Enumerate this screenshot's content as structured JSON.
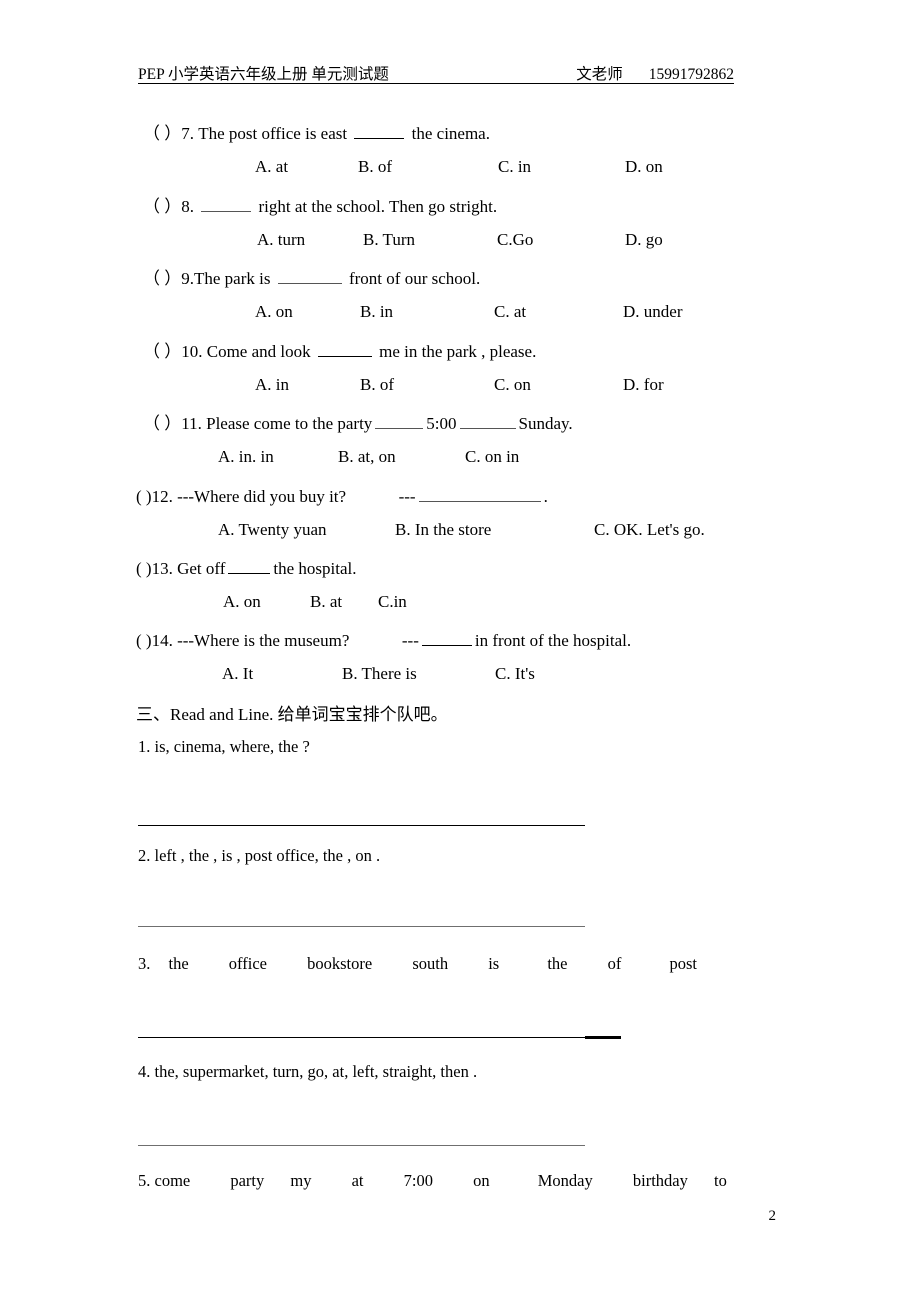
{
  "header": {
    "title": "PEP 小学英语六年级上册  单元测试题",
    "teacher": "文老师",
    "phone": "15991792862"
  },
  "multiple_choice": {
    "questions": [
      {
        "marker": "（    ）",
        "number": "7.",
        "stem_before": "The post office is east",
        "stem_after": "the cinema.",
        "options": [
          "A. at",
          "B. of",
          "C. in",
          "D. on"
        ]
      },
      {
        "marker": "（    ）",
        "number": "8.",
        "stem_before": "",
        "stem_after": "right at the school. Then go stright.",
        "options": [
          "A. turn",
          "B. Turn",
          "C.Go",
          "D. go"
        ]
      },
      {
        "marker": "（    ）",
        "number": "9.",
        "stem_before": "The park is",
        "stem_after": "front of our school.",
        "options": [
          "A. on",
          "B. in",
          "C. at",
          "D. under"
        ]
      },
      {
        "marker": "（    ）",
        "number": "10.",
        "stem_before": "Come and look",
        "stem_after": "me in the park , please.",
        "options": [
          "A. in",
          "B. of",
          "C. on",
          "D. for"
        ]
      },
      {
        "marker": "（    ）",
        "number": "11.",
        "stem_before": "Please come to the party",
        "stem_mid": "5:00",
        "stem_after": "Sunday.",
        "options": [
          "A. in.    in",
          "B. at,    on",
          "C. on        in"
        ]
      },
      {
        "marker": "(      )",
        "number": "12.",
        "stem_before": "---Where did you buy it?",
        "stem_after": "---",
        "stem_tail": ".",
        "options": [
          "A. Twenty yuan",
          "B. In the store",
          "C. OK. Let's go."
        ]
      },
      {
        "marker": "(      )",
        "number": "13.",
        "stem_before": "Get off",
        "stem_after": "the hospital.",
        "options": [
          "A. on",
          "B. at",
          "C.in"
        ]
      },
      {
        "marker": "(      )",
        "number": "14.",
        "stem_before": "---Where is the museum?",
        "stem_mid": "---",
        "stem_after": "in front of the hospital.",
        "options": [
          "A. It",
          "B. There is",
          "C. It's"
        ]
      }
    ]
  },
  "section_three": {
    "heading": "三、Read and Line.  给单词宝宝排个队吧。",
    "items": [
      {
        "number": "1.",
        "text": "is,    cinema,    where,    the ?"
      },
      {
        "number": "2.",
        "text": "left , the , is , post office, the , on ."
      },
      {
        "number": "3.",
        "words": [
          "the",
          "office",
          "bookstore",
          "south",
          "is",
          "the",
          "of",
          "post"
        ]
      },
      {
        "number": "4.",
        "text": "the, supermarket, turn, go, at, left, straight, then ."
      },
      {
        "number": "5.",
        "words": [
          "come",
          "party",
          "my",
          "at",
          "7:00",
          "on",
          "Monday",
          "birthday",
          "to"
        ]
      }
    ]
  },
  "footer": {
    "page_number": "2"
  }
}
